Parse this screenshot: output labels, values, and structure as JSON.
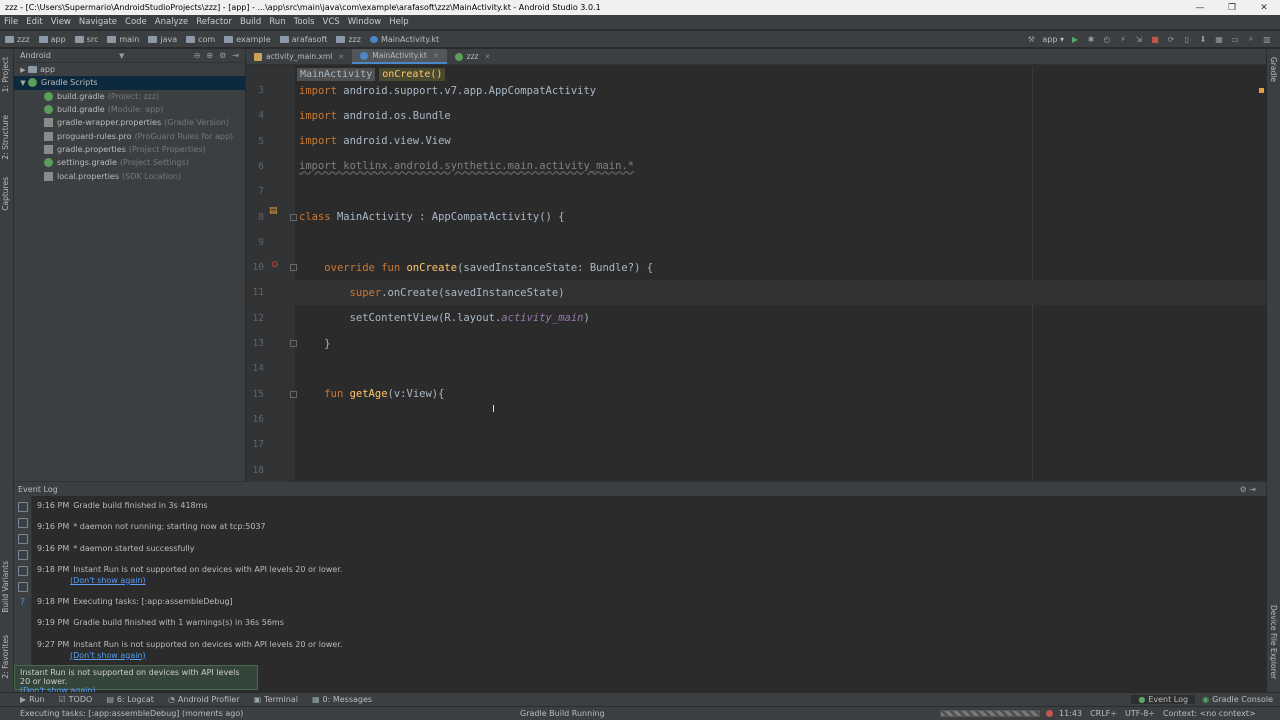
{
  "window": {
    "title": "zzz - [C:\\Users\\Supermario\\AndroidStudioProjects\\zzz] - [app] - ...\\app\\src\\main\\java\\com\\example\\arafasoft\\zzz\\MainActivity.kt - Android Studio 3.0.1"
  },
  "menu": [
    "File",
    "Edit",
    "View",
    "Navigate",
    "Code",
    "Analyze",
    "Refactor",
    "Build",
    "Run",
    "Tools",
    "VCS",
    "Window",
    "Help"
  ],
  "breadcrumb": [
    "zzz",
    "app",
    "src",
    "main",
    "java",
    "com",
    "example",
    "arafasoft",
    "zzz",
    "MainActivity.kt"
  ],
  "run_config": "app",
  "left_strip": {
    "project": "1: Project",
    "structure": "2: Structure",
    "captures": "Captures",
    "build_variants": "Build Variants",
    "favorites": "2: Favorites"
  },
  "right_strip": {
    "gradle": "Gradle",
    "device_explorer": "Device File Explorer"
  },
  "project": {
    "view": "Android",
    "tree": [
      {
        "label": "app",
        "hint": "",
        "indent": 0,
        "arrow": "▶",
        "icon": "folder"
      },
      {
        "label": "Gradle Scripts",
        "hint": "",
        "indent": 0,
        "arrow": "▼",
        "icon": "gradle",
        "selected": true
      },
      {
        "label": "build.gradle",
        "hint": "(Project: zzz)",
        "indent": 1,
        "icon": "gradle"
      },
      {
        "label": "build.gradle",
        "hint": "(Module: app)",
        "indent": 1,
        "icon": "gradle"
      },
      {
        "label": "gradle-wrapper.properties",
        "hint": "(Gradle Version)",
        "indent": 1,
        "icon": "file"
      },
      {
        "label": "proguard-rules.pro",
        "hint": "(ProGuard Rules for app)",
        "indent": 1,
        "icon": "file"
      },
      {
        "label": "gradle.properties",
        "hint": "(Project Properties)",
        "indent": 1,
        "icon": "file"
      },
      {
        "label": "settings.gradle",
        "hint": "(Project Settings)",
        "indent": 1,
        "icon": "gradle"
      },
      {
        "label": "local.properties",
        "hint": "(SDK Location)",
        "indent": 1,
        "icon": "file"
      }
    ]
  },
  "tabs": [
    {
      "label": "activity_main.xml",
      "active": false
    },
    {
      "label": "MainActivity.kt",
      "active": true
    },
    {
      "label": "zzz",
      "active": false
    }
  ],
  "editor": {
    "crumbs": [
      "MainActivity",
      "onCreate()"
    ],
    "lines": [
      {
        "n": "3",
        "segs": [
          [
            "kw",
            "import "
          ],
          [
            "",
            "android.support.v7.app.AppCompatActivity"
          ]
        ]
      },
      {
        "n": "4",
        "segs": [
          [
            "kw",
            "import "
          ],
          [
            "",
            "android.os.Bundle"
          ]
        ]
      },
      {
        "n": "5",
        "segs": [
          [
            "kw",
            "import "
          ],
          [
            "",
            "android.view.View"
          ]
        ]
      },
      {
        "n": "6",
        "segs": [
          [
            "dim",
            "import kotlinx.android.synthetic.main.activity_main.*"
          ]
        ]
      },
      {
        "n": "7",
        "segs": []
      },
      {
        "n": "8",
        "segs": [
          [
            "kw",
            "class "
          ],
          [
            "",
            "MainActivity : AppCompatActivity() {"
          ]
        ]
      },
      {
        "n": "9",
        "segs": []
      },
      {
        "n": "10",
        "segs": [
          [
            "",
            "    "
          ],
          [
            "kw",
            "override fun "
          ],
          [
            "fn",
            "onCreate"
          ],
          [
            "",
            "(savedInstanceState: Bundle?) {"
          ]
        ]
      },
      {
        "n": "11",
        "segs": [
          [
            "",
            "        "
          ],
          [
            "kw",
            "super"
          ],
          [
            "",
            ".onCreate(savedInstanceState)"
          ]
        ],
        "current": true
      },
      {
        "n": "12",
        "segs": [
          [
            "",
            "        setContentView(R.layout."
          ],
          [
            "it",
            "activity_main"
          ],
          [
            "",
            ")"
          ]
        ]
      },
      {
        "n": "13",
        "segs": [
          [
            "",
            "    }"
          ]
        ]
      },
      {
        "n": "14",
        "segs": []
      },
      {
        "n": "15",
        "segs": [
          [
            "",
            "    "
          ],
          [
            "kw",
            "fun "
          ],
          [
            "fn",
            "getAge"
          ],
          [
            "",
            "(v:View){"
          ]
        ]
      },
      {
        "n": "16",
        "segs": []
      },
      {
        "n": "17",
        "segs": []
      },
      {
        "n": "18",
        "segs": []
      }
    ]
  },
  "event_log": {
    "title": "Event Log",
    "entries": [
      {
        "time": "9:16 PM",
        "text": "Gradle build finished in 3s 418ms"
      },
      {
        "time": "9:16 PM",
        "text": "* daemon not running; starting now at tcp:5037"
      },
      {
        "time": "9:16 PM",
        "text": "* daemon started successfully"
      },
      {
        "time": "9:18 PM",
        "text": "Instant Run is not supported on devices with API levels 20 or lower.",
        "link": "(Don't show again)"
      },
      {
        "time": "9:18 PM",
        "text": "Executing tasks: [:app:assembleDebug]"
      },
      {
        "time": "9:19 PM",
        "text": "Gradle build finished with 1 warnings(s) in 36s 56ms"
      },
      {
        "time": "9:27 PM",
        "text": "Instant Run is not supported on devices with API levels 20 or lower.",
        "link": "(Don't show again)"
      }
    ]
  },
  "balloon": {
    "text": "Instant Run is not supported on devices with API levels 20 or lower.",
    "link": "(Don't show again)"
  },
  "toolwindows": {
    "left": [
      {
        "label": "Run",
        "icon": "▶"
      },
      {
        "label": "TODO",
        "icon": "☑"
      },
      {
        "label": "6: Logcat",
        "icon": "▤"
      },
      {
        "label": "Android Profiler",
        "icon": "◔"
      },
      {
        "label": "Terminal",
        "icon": "▣"
      },
      {
        "label": "0: Messages",
        "icon": "▦"
      }
    ],
    "right": [
      {
        "label": "Event Log",
        "icon": "●",
        "active": true
      },
      {
        "label": "Gradle Console",
        "icon": "◉",
        "active": false
      }
    ]
  },
  "status": {
    "message": "Executing tasks: [:app:assembleDebug] (moments ago)",
    "center": "Gradle Build Running",
    "position": "11:43",
    "line_sep": "CRLF÷",
    "encoding": "UTF-8÷",
    "context": "Context: <no context>"
  }
}
